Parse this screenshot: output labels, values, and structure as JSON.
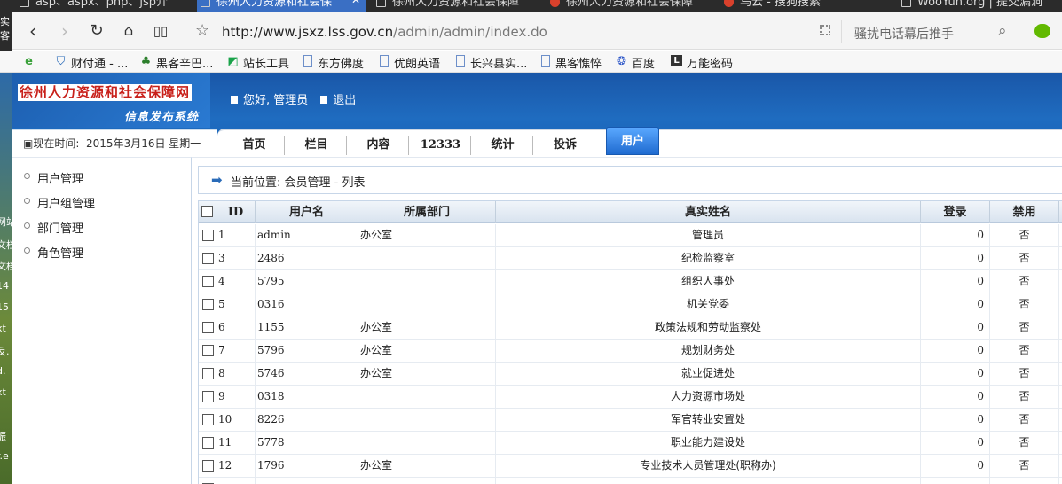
{
  "browser": {
    "tabs": [
      {
        "label": "asp、aspx、php、jsp介",
        "active": false
      },
      {
        "label": "徐州人力资源和社会保",
        "active": true
      },
      {
        "label": "徐州人力资源和社会保障",
        "active": false
      },
      {
        "label": "徐州人力资源和社会保障",
        "active": false
      },
      {
        "label": "乌云 - 搜狗搜索",
        "active": false
      },
      {
        "label": "WooYun.org | 提交漏洞",
        "active": false
      }
    ],
    "url_host": "http://www.jsxz.lss.gov.cn",
    "url_path": "/admin/admin/index.do",
    "search_placeholder": "骚扰电话幕后推手",
    "bookmarks": [
      "财付通 - ...",
      "黑客辛巴...",
      "站长工具",
      "东方佛度",
      "优朗英语",
      "长兴县实...",
      "黑客憔悴",
      "百度",
      "万能密码"
    ]
  },
  "desktop_edge": [
    "实",
    "客",
    "网站",
    "文档",
    "文档",
    "14",
    "15",
    "xt",
    "反.",
    "d.",
    "xt",
    "振",
    "r.e"
  ],
  "header": {
    "logo_title": "徐州人力资源和社会保障网",
    "logo_subtitle": "信息发布系统",
    "greeting": "您好, 管理员",
    "logout": "退出",
    "time_label": "现在时间:",
    "time_value": "2015年3月16日 星期一"
  },
  "nav": {
    "items": [
      "首页",
      "栏目",
      "内容",
      "12333",
      "统计",
      "投诉",
      "用户"
    ],
    "active": "用户"
  },
  "sidebar": {
    "items": [
      "用户管理",
      "用户组管理",
      "部门管理",
      "角色管理"
    ]
  },
  "breadcrumb": "当前位置: 会员管理 - 列表",
  "table": {
    "columns": [
      "ID",
      "用户名",
      "所属部门",
      "真实姓名",
      "登录",
      "禁用"
    ],
    "rows": [
      {
        "id": "1",
        "username": "admin",
        "dept": "办公室",
        "realname": "管理员",
        "logins": "0",
        "disabled": "否"
      },
      {
        "id": "3",
        "username": "2486",
        "dept": "",
        "realname": "纪检监察室",
        "logins": "0",
        "disabled": "否"
      },
      {
        "id": "4",
        "username": "5795",
        "dept": "",
        "realname": "组织人事处",
        "logins": "0",
        "disabled": "否"
      },
      {
        "id": "5",
        "username": "0316",
        "dept": "",
        "realname": "机关党委",
        "logins": "0",
        "disabled": "否"
      },
      {
        "id": "6",
        "username": "1155",
        "dept": "办公室",
        "realname": "政策法规和劳动监察处",
        "logins": "0",
        "disabled": "否"
      },
      {
        "id": "7",
        "username": "5796",
        "dept": "办公室",
        "realname": "规划财务处",
        "logins": "0",
        "disabled": "否"
      },
      {
        "id": "8",
        "username": "5746",
        "dept": "办公室",
        "realname": "就业促进处",
        "logins": "0",
        "disabled": "否"
      },
      {
        "id": "9",
        "username": "0318",
        "dept": "",
        "realname": "人力资源市场处",
        "logins": "0",
        "disabled": "否"
      },
      {
        "id": "10",
        "username": "8226",
        "dept": "",
        "realname": "军官转业安置处",
        "logins": "0",
        "disabled": "否"
      },
      {
        "id": "11",
        "username": "5778",
        "dept": "",
        "realname": "职业能力建设处",
        "logins": "0",
        "disabled": "否"
      },
      {
        "id": "12",
        "username": "1796",
        "dept": "办公室",
        "realname": "专业技术人员管理处(职称办)",
        "logins": "0",
        "disabled": "否"
      },
      {
        "id": "",
        "username": "",
        "dept": "",
        "realname": "",
        "logins": "",
        "disabled": ""
      }
    ]
  }
}
